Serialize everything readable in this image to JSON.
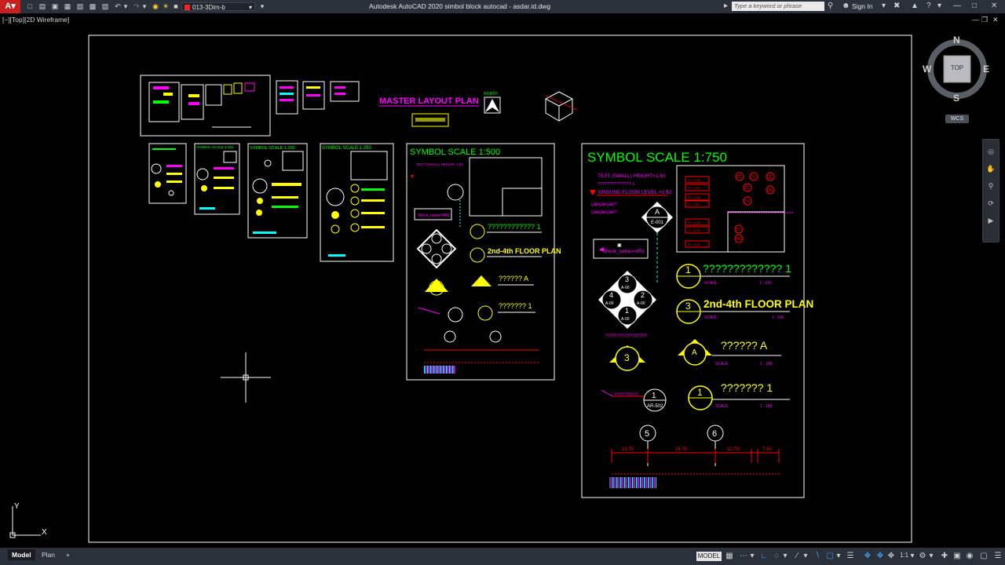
{
  "titlebar": {
    "app_letter": "A",
    "workspace": "013-3Dim-b",
    "title": "Autodesk AutoCAD 2020   simbol block autocad - asdar.id.dwg",
    "search_placeholder": "Type a keyword or phrase",
    "signin": "Sign In"
  },
  "viewport": {
    "label": "[−][Top][2D Wireframe]"
  },
  "viewcube": {
    "north": "N",
    "south": "S",
    "east": "E",
    "west": "W",
    "face": "TOP",
    "wcs": "WCS"
  },
  "ucs": {
    "x": "X",
    "y": "Y"
  },
  "sheets": {
    "master_title": "MASTER LAYOUT PLAN",
    "north_label": "NORTH",
    "scale_250": "SYMBOL SCALE 1:250",
    "scale_200": "SYMBOL SCALE 1:200",
    "scale_100": "SYMBOL SCALE 1:100",
    "scale_500": "SYMBOL SCALE 1:500",
    "scale_750": "SYMBOL SCALE 1:750"
  },
  "sheet750": {
    "text_small": "TEXT (SMALL) HEIGHT=1.50",
    "qmarks_1": "?????????????? 1",
    "ground_floor": "GROUND FLOOR LEVEL +0.50",
    "sub_a": "çäèçäèçäè²²",
    "sub_b": "çäèçäèçäè²²",
    "block_name": "Block_name=AR1",
    "marker_a": "A",
    "marker_e001": "E-001",
    "title1": "????????????? 1",
    "floor_plan": "2nd-4th FLOOR PLAN",
    "title_a": "?????? A",
    "title_1": "??????? 1",
    "scale_lbl": "SCALE",
    "scale_val": "1 : 100",
    "section_label": "????????????????",
    "ar_ref": "?????????",
    "dims": [
      "12.75",
      "24.75",
      "12.75",
      "7.00"
    ],
    "grid5": "5",
    "grid6": "6",
    "num3": "3",
    "num4": "4",
    "num2": "2",
    "num1": "1",
    "a00": "A-00",
    "ar502": "AR-502",
    "p_labels": [
      "P2",
      "P1",
      "D5",
      "P1",
      "M1",
      "P2",
      "D1",
      "M1"
    ],
    "room_boxes": [
      "F1 +0.50",
      "F2 -1.45",
      "F1 +0.50",
      "F2 -1.45",
      "F1 +0.50",
      "F2 +0.50",
      "F1 +0.50"
    ]
  },
  "sheet500": {
    "text_small": "TEXT (SMALL) HEIGHT=1.50",
    "floor_plan": "2nd-4th FLOOR PLAN",
    "title1": "???????????? 1",
    "title_a": "?????? A",
    "title_1": "??????? 1",
    "block_name": "Block_name=AR1"
  },
  "status": {
    "tab_model": "Model",
    "tab_plan": "Plan",
    "tab_add": "+",
    "model_btn": "MODEL",
    "scale": "1:1"
  }
}
